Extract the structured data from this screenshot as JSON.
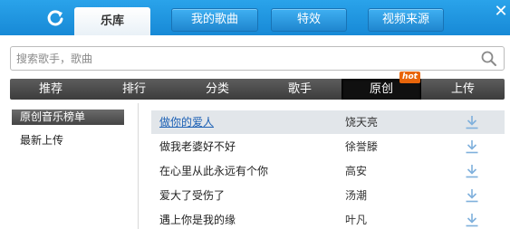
{
  "header": {
    "active_tab": "乐库",
    "tabs": [
      "我的歌曲",
      "特效",
      "视频来源"
    ],
    "close_glyph": "✕",
    "accent": "#1789d6"
  },
  "search": {
    "placeholder": "搜索歌手，歌曲",
    "value": ""
  },
  "nav": {
    "items": [
      "推荐",
      "排行",
      "分类",
      "歌手",
      "原创",
      "上传"
    ],
    "active": "原创",
    "badge": "hot"
  },
  "sidebar": {
    "items": [
      "原创音乐榜单",
      "最新上传"
    ],
    "active": "原创音乐榜单"
  },
  "songs": [
    {
      "title": "做你的爱人",
      "artist": "饶天亮"
    },
    {
      "title": "做我老婆好不好",
      "artist": "徐誉滕"
    },
    {
      "title": "在心里从此永远有个你",
      "artist": "高安"
    },
    {
      "title": "爱大了受伤了",
      "artist": "汤潮"
    },
    {
      "title": "遇上你是我的缘",
      "artist": "叶凡"
    }
  ],
  "icons": {
    "refresh": "refresh-icon",
    "search": "search-icon",
    "download": "download-icon",
    "close": "close-icon"
  }
}
